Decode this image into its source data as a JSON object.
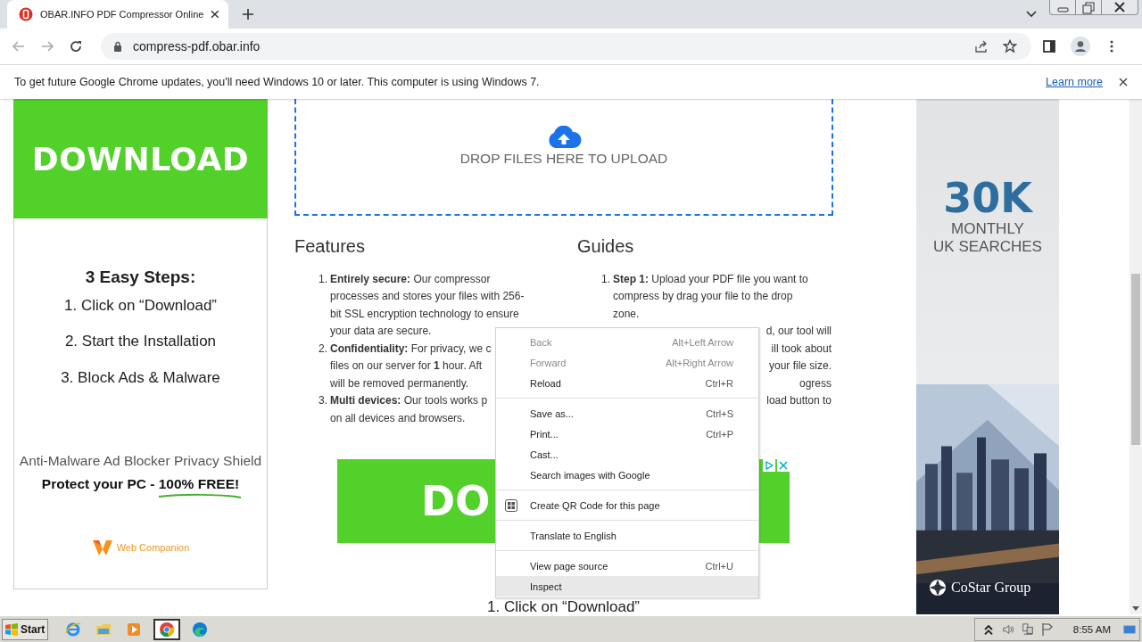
{
  "browser": {
    "tab": {
      "title": "OBAR.INFO PDF Compressor Online",
      "selected": true
    },
    "address": "compress-pdf.obar.info",
    "infobar": {
      "message": "To get future Google Chrome updates, you'll need Windows 10 or later. This computer is using Windows 7.",
      "link": "Learn more"
    }
  },
  "left_ad": {
    "banner": "DOWNLOAD",
    "heading": "3 Easy Steps:",
    "steps": [
      "1. Click on “Download”",
      "2. Start the Installation",
      "3. Block Ads & Malware"
    ],
    "tagline": "Anti-Malware Ad Blocker Privacy Shield",
    "offer": "Protect your PC - 100% FREE!",
    "brand": "Web Companion"
  },
  "upload": {
    "label": "DROP FILES HERE TO UPLOAD"
  },
  "features": {
    "title": "Features",
    "items": [
      {
        "number": "1.",
        "lines": [
          "**Entirely secure:** Our compressor",
          "processes and stores your files with 256-",
          "bit SSL encryption technology to ensure",
          "your data are secure."
        ]
      },
      {
        "number": "2.",
        "lines": [
          "**Confidentiality:** For privacy, we c",
          "files on our server for **1** hour. Aft",
          "will be removed permanently."
        ]
      },
      {
        "number": "3.",
        "lines": [
          "**Multi devices:** Our tools works p",
          "on all devices and browsers."
        ]
      }
    ]
  },
  "guides": {
    "title": "Guides",
    "items": [
      {
        "number": "1.",
        "lines": [
          "**Step 1:** Upload your PDF file you want to",
          "compress by drag your file to the drop",
          "zone."
        ]
      }
    ],
    "fragments": [
      "d, our tool will",
      "ill took about",
      "your file size.",
      "ogress",
      "load button to"
    ]
  },
  "ad_banner": {
    "banner": "DO",
    "step": "1. Click on “Download”"
  },
  "right_ad": {
    "figure": "30K",
    "lines": [
      "MONTHLY",
      "UK SEARCHES"
    ],
    "brand": "CoStar Group"
  },
  "context_menu": {
    "groups": [
      [
        {
          "kind": "plain",
          "label": "Back",
          "shortcut": "Alt+Left Arrow",
          "disabled": true,
          "selected": false
        },
        {
          "kind": "plain",
          "label": "Forward",
          "shortcut": "Alt+Right Arrow",
          "disabled": true,
          "selected": false
        },
        {
          "kind": "plain",
          "label": "Reload",
          "shortcut": "Ctrl+R",
          "disabled": false,
          "selected": false
        }
      ],
      [
        {
          "kind": "plain",
          "label": "Save as...",
          "shortcut": "Ctrl+S",
          "disabled": false,
          "selected": false
        },
        {
          "kind": "plain",
          "label": "Print...",
          "shortcut": "Ctrl+P",
          "disabled": false,
          "selected": false
        },
        {
          "kind": "plain",
          "label": "Cast...",
          "disabled": false,
          "selected": false
        },
        {
          "kind": "plain",
          "label": "Search images with Google",
          "disabled": false,
          "selected": false
        }
      ],
      [
        {
          "kind": "qr",
          "label": "Create QR Code for this page",
          "disabled": false,
          "selected": false
        }
      ],
      [
        {
          "kind": "plain",
          "label": "Translate to English",
          "disabled": false,
          "selected": false
        }
      ],
      [
        {
          "kind": "plain",
          "label": "View page source",
          "shortcut": "Ctrl+U",
          "disabled": false,
          "selected": false
        },
        {
          "kind": "plain",
          "label": "Inspect",
          "disabled": false,
          "selected": true
        }
      ]
    ]
  },
  "taskbar": {
    "start": "Start",
    "apps": [
      {
        "kind": "ie",
        "selected": false
      },
      {
        "kind": "explorer",
        "selected": false
      },
      {
        "kind": "media",
        "selected": false
      },
      {
        "kind": "chrome",
        "selected": true
      },
      {
        "kind": "edge",
        "selected": false
      }
    ],
    "clock": "8:55 AM"
  }
}
